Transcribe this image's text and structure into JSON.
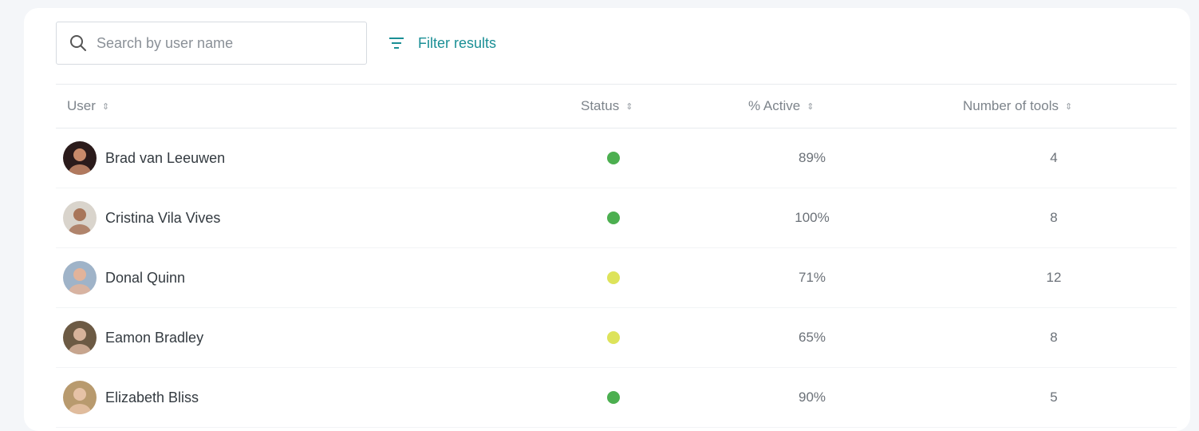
{
  "search": {
    "placeholder": "Search by user name",
    "icon": "search-icon"
  },
  "filter": {
    "label": "Filter results",
    "icon": "filter-icon",
    "color": "#1a8f95"
  },
  "table": {
    "columns": [
      {
        "label": "User",
        "sort_icon": "sort-icon"
      },
      {
        "label": "Status",
        "sort_icon": "sort-icon"
      },
      {
        "label": "% Active",
        "sort_icon": "sort-icon"
      },
      {
        "label": "Number of tools",
        "sort_icon": "sort-icon"
      }
    ],
    "rows": [
      {
        "name": "Brad van Leeuwen",
        "status": "green",
        "active": "89%",
        "tools": "4",
        "avatar_bg": "#2b1b1b",
        "avatar_skin": "#c98a6a"
      },
      {
        "name": "Cristina Vila Vives",
        "status": "green",
        "active": "100%",
        "tools": "8",
        "avatar_bg": "#d9d4cc",
        "avatar_skin": "#a8765a"
      },
      {
        "name": "Donal Quinn",
        "status": "yellow",
        "active": "71%",
        "tools": "12",
        "avatar_bg": "#9fb3c8",
        "avatar_skin": "#e2b39a"
      },
      {
        "name": "Eamon Bradley",
        "status": "yellow",
        "active": "65%",
        "tools": "8",
        "avatar_bg": "#6c5a44",
        "avatar_skin": "#d7b39b"
      },
      {
        "name": "Elizabeth Bliss",
        "status": "green",
        "active": "90%",
        "tools": "5",
        "avatar_bg": "#b89a6e",
        "avatar_skin": "#e6c2a6"
      }
    ]
  },
  "colors": {
    "status_green": "#4caf50",
    "status_yellow": "#dde35a"
  }
}
